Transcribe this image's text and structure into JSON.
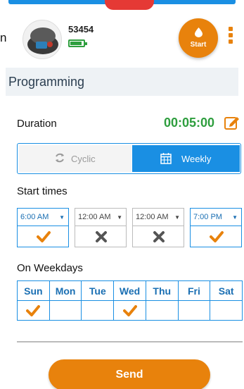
{
  "device": {
    "id": "53454",
    "battery_level": 0.8
  },
  "header": {
    "partial_char": "n",
    "start_label": "Start"
  },
  "section": {
    "title": "Programming"
  },
  "duration": {
    "label": "Duration",
    "value": "00:05:00"
  },
  "mode": {
    "options": [
      "Cyclic",
      "Weekly"
    ],
    "selected": "Weekly"
  },
  "start_times": {
    "label": "Start times",
    "slots": [
      {
        "time": "6:00 AM",
        "enabled": true
      },
      {
        "time": "12:00 AM",
        "enabled": false
      },
      {
        "time": "12:00 AM",
        "enabled": false
      },
      {
        "time": "7:00 PM",
        "enabled": true
      }
    ]
  },
  "weekdays": {
    "label": "On Weekdays",
    "days": [
      "Sun",
      "Mon",
      "Tue",
      "Wed",
      "Thu",
      "Fri",
      "Sat"
    ],
    "selected": [
      true,
      false,
      false,
      true,
      false,
      false,
      false
    ]
  },
  "footer": {
    "send_label": "Send"
  },
  "colors": {
    "accent": "#e8820c",
    "primary": "#1a8fe3",
    "success": "#2e9e3e",
    "alert": "#e53935"
  }
}
